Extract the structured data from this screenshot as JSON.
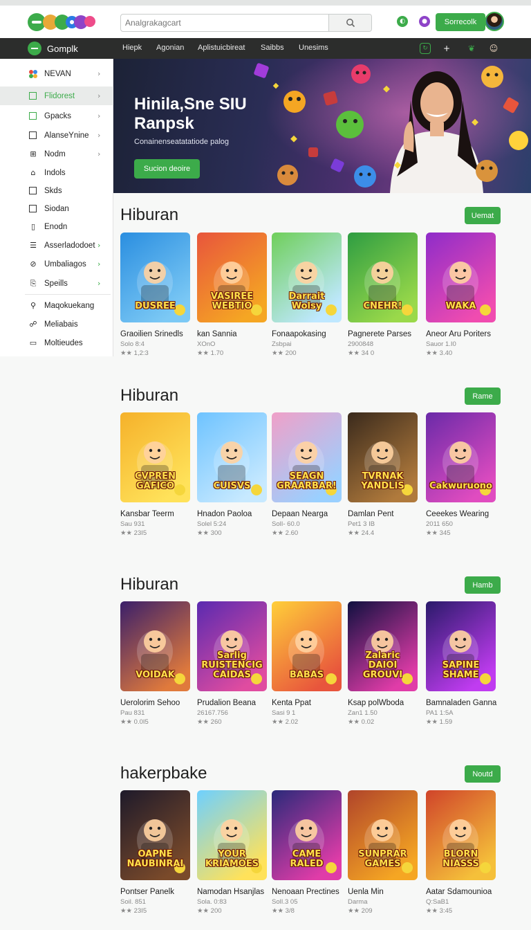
{
  "search": {
    "placeholder": "Analgrakagcart"
  },
  "header": {
    "signin_label": "Sorrecolk"
  },
  "navbar": {
    "brand": "Gomplk",
    "links": [
      "Hiepk",
      "Agonian",
      "Aplistuicbireat",
      "Saibbs",
      "Unesims"
    ]
  },
  "sidebar": {
    "items": [
      {
        "label": "NEVAN",
        "icon": "colorful-grid-icon",
        "chevron": true
      },
      {
        "label": "Flidorest",
        "icon": "square-icon",
        "chevron": true,
        "active": true
      },
      {
        "label": "Gpacks",
        "icon": "square-icon",
        "chevron": true
      },
      {
        "label": "AlanseYnine",
        "icon": "square-icon",
        "chevron": true
      },
      {
        "label": "Nodm",
        "icon": "book-icon",
        "chevron": true
      },
      {
        "label": "Indols",
        "icon": "tag-icon",
        "chevron": false
      },
      {
        "label": "Skds",
        "icon": "square-icon",
        "chevron": false
      },
      {
        "label": "Siodan",
        "icon": "square-icon",
        "chevron": false
      },
      {
        "label": "Enodn",
        "icon": "doc-icon",
        "chevron": false
      },
      {
        "label": "Asserladodoet",
        "icon": "list-icon",
        "chevron": true
      },
      {
        "label": "Umbaliagos",
        "icon": "tag-icon",
        "chevron": true
      },
      {
        "label": "Speills",
        "icon": "clipboard-icon",
        "chevron": true
      },
      {
        "label": "Maqokuekang",
        "icon": "link-icon",
        "chevron": false
      },
      {
        "label": "Meliabais",
        "icon": "people-icon",
        "chevron": false
      },
      {
        "label": "Moltieudes",
        "icon": "monitor-icon",
        "chevron": false
      }
    ]
  },
  "hero": {
    "title": "Hinila,Sne SIU Ranpsk",
    "subtitle": "Conainenseatatatiode palog",
    "button_label": "Sucion deoire"
  },
  "sections": [
    {
      "title": "Hiburan",
      "button_label": "Uemat",
      "cards": [
        {
          "title": "Graoilien Srinedls",
          "meta": "Solo 8:4",
          "rating": "★★ 1,2:3"
        },
        {
          "title": "kan Sannia",
          "meta": "XOnO",
          "rating": "★★ 1.70"
        },
        {
          "title": "Fonaapokasing",
          "meta": "Zsbpai",
          "rating": "★★ 200"
        },
        {
          "title": "Pagnerete Parses",
          "meta": "2900848",
          "rating": "★★ 34 0"
        },
        {
          "title": "Aneor Aru Poriters",
          "meta": "Sauor 1.I0",
          "rating": "★★ 3.40"
        }
      ]
    },
    {
      "title": "Hiburan",
      "button_label": "Rame",
      "cards": [
        {
          "title": "Kansbar Teerm",
          "meta": "Sau 931",
          "rating": "★★ 23I5"
        },
        {
          "title": "Hnadon Paoloa",
          "meta": "Solel 5:24",
          "rating": "★★ 300"
        },
        {
          "title": "Depaan Nearga",
          "meta": "SolI- 60.0",
          "rating": "★★ 2.60"
        },
        {
          "title": "Damlan Pent",
          "meta": "Pet1 3 IB",
          "rating": "★★ 24.4"
        },
        {
          "title": "Ceeekes Wearing",
          "meta": "2011 650",
          "rating": "★★ 345"
        }
      ]
    },
    {
      "title": "Hiburan",
      "button_label": "Hamb",
      "cards": [
        {
          "title": "Uerolorim Sehoo",
          "meta": "Pau 831",
          "rating": "★★ 0.0I5"
        },
        {
          "title": "Prudalion Beana",
          "meta": "26167.756",
          "rating": "★★ 260"
        },
        {
          "title": "Kenta Ppat",
          "meta": "Sasi 9 1",
          "rating": "★★ 2.02"
        },
        {
          "title": "Ksap polWboda",
          "meta": "Zan1 1.50",
          "rating": "★★ 0.02"
        },
        {
          "title": "Bamnaladen Ganna",
          "meta": "PA1 1:5A",
          "rating": "★★ 1.59"
        }
      ]
    },
    {
      "title": "hakerpbake",
      "button_label": "Noutd",
      "cards": [
        {
          "title": "Pontser Panelk",
          "meta": "Soil. 851",
          "rating": "★★ 23I5"
        },
        {
          "title": "Namodan Hsanjlas",
          "meta": "Sola. 0:83",
          "rating": "★★ 200"
        },
        {
          "title": "Nenoaan Prectines",
          "meta": "SolI.3 05",
          "rating": "★★ 3/8"
        },
        {
          "title": "Uenla Min",
          "meta": "Darma",
          "rating": "★★ 209"
        },
        {
          "title": "Aatar Sdamounioa",
          "meta": "Q:SaB1",
          "rating": "★★ 3:45"
        }
      ]
    }
  ],
  "thumb_art_text": [
    [
      "DUSREE",
      "VASIREE WEBTIO",
      "Darrait Wolsy",
      "CNEHR!",
      "WAKA"
    ],
    [
      "CVPREN GAFICO",
      "CUISVS",
      "SEAGN GRAARBAR!",
      "TVRNAK YANDLIS",
      "Cakwuruono"
    ],
    [
      "VOIDAK",
      "Sarlig RUISTENCIG CAIDAS",
      "BABAS",
      "Zalaric DAIOI GROUVI",
      "SAPINE SHAME"
    ],
    [
      "OAPNE NAUBINRAI",
      "YOUR KRIAMOES",
      "CAME RALED",
      "SUNPRAR GAMES",
      "BLORN NIASSS"
    ]
  ],
  "colors": {
    "accent": "#3cab4a",
    "navbar": "#2c2d2c"
  }
}
